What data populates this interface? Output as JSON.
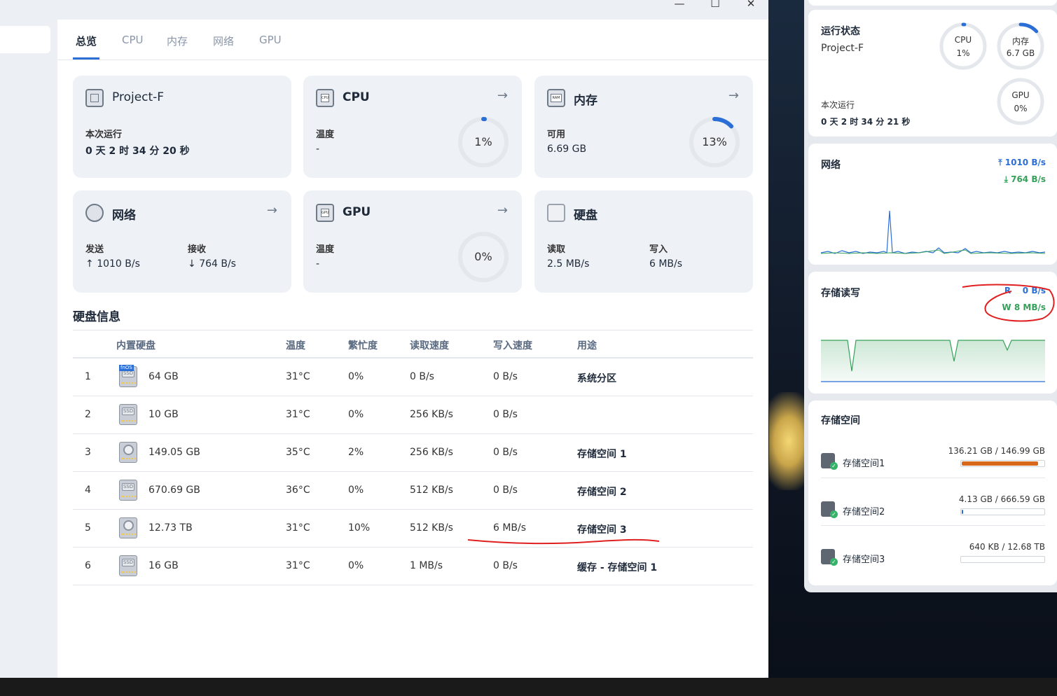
{
  "window": {
    "controls": {
      "minimize": "—",
      "maximize": "☐",
      "close": "✕"
    }
  },
  "tabs": [
    {
      "label": "总览",
      "active": true
    },
    {
      "label": "CPU",
      "active": false
    },
    {
      "label": "内存",
      "active": false
    },
    {
      "label": "网络",
      "active": false
    },
    {
      "label": "GPU",
      "active": false
    }
  ],
  "cards": {
    "system": {
      "name": "Project-F",
      "uptime_label": "本次运行",
      "uptime_value": "0 天 2 时 34 分 20 秒"
    },
    "cpu": {
      "title": "CPU",
      "temp_label": "温度",
      "temp_value": "-",
      "usage": "1%",
      "usage_fraction": 0.01
    },
    "memory": {
      "title": "内存",
      "avail_label": "可用",
      "avail_value": "6.69 GB",
      "usage": "13%",
      "usage_fraction": 0.13
    },
    "network": {
      "title": "网络",
      "send_label": "发送",
      "send_value": "1010 B/s",
      "recv_label": "接收",
      "recv_value": "764 B/s"
    },
    "gpu": {
      "title": "GPU",
      "temp_label": "温度",
      "temp_value": "-",
      "usage": "0%",
      "usage_fraction": 0
    },
    "disk": {
      "title": "硬盘",
      "read_label": "读取",
      "read_value": "2.5 MB/s",
      "write_label": "写入",
      "write_value": "6 MB/s"
    }
  },
  "disk_info": {
    "title": "硬盘信息",
    "headers": [
      "内置硬盘",
      "温度",
      "繁忙度",
      "读取速度",
      "写入速度",
      "用途"
    ],
    "rows": [
      {
        "idx": "1",
        "type": "ssd",
        "badge": "fnOS",
        "size": "64 GB",
        "temp": "31°C",
        "busy": "0%",
        "read": "0 B/s",
        "write": "0 B/s",
        "use": "系统分区"
      },
      {
        "idx": "2",
        "type": "ssd",
        "badge": "",
        "size": "10 GB",
        "temp": "31°C",
        "busy": "0%",
        "read": "256 KB/s",
        "write": "0 B/s",
        "use": ""
      },
      {
        "idx": "3",
        "type": "hdd",
        "badge": "",
        "size": "149.05 GB",
        "temp": "35°C",
        "busy": "2%",
        "read": "256 KB/s",
        "write": "0 B/s",
        "use": "存储空间 1"
      },
      {
        "idx": "4",
        "type": "ssd",
        "badge": "",
        "size": "670.69 GB",
        "temp": "36°C",
        "busy": "0%",
        "read": "512 KB/s",
        "write": "0 B/s",
        "use": "存储空间 2"
      },
      {
        "idx": "5",
        "type": "hdd",
        "badge": "",
        "size": "12.73 TB",
        "temp": "31°C",
        "busy": "10%",
        "read": "512 KB/s",
        "write": "6 MB/s",
        "use": "存储空间 3"
      },
      {
        "idx": "6",
        "type": "ssd",
        "badge": "",
        "size": "16 GB",
        "temp": "31°C",
        "busy": "0%",
        "read": "1 MB/s",
        "write": "0 B/s",
        "use": "缓存 - 存储空间 1"
      }
    ],
    "ssd_label": "SSD"
  },
  "widgets": {
    "status": {
      "title": "运行状态",
      "host": "Project-F",
      "uptime_label": "本次运行",
      "uptime_value": "0 天 2 时 34 分 21 秒",
      "rings": [
        {
          "label": "CPU",
          "value": "1%",
          "fraction": 0.01
        },
        {
          "label": "内存",
          "value": "6.7 GB",
          "fraction": 0.13
        },
        {
          "label": "GPU",
          "value": "0%",
          "fraction": 0
        }
      ]
    },
    "network": {
      "title": "网络",
      "up": "1010 B/s",
      "down": "764 B/s",
      "up_color": "#2b6fd6",
      "down_color": "#36a05a"
    },
    "storage_io": {
      "title": "存储读写",
      "r_label": "R",
      "r_value": "0 B/s",
      "w_label": "W",
      "w_value": "8 MB/s"
    },
    "storage_space": {
      "title": "存储空间",
      "items": [
        {
          "name": "存储空间1",
          "used": "136.21 GB",
          "total": "146.99 GB",
          "fraction": 0.93,
          "color": "#d9691a"
        },
        {
          "name": "存储空间2",
          "used": "4.13 GB",
          "total": "666.59 GB",
          "fraction": 0.01,
          "color": "#2b6fd6"
        },
        {
          "name": "存储空间3",
          "used": "640 KB",
          "total": "12.68 TB",
          "fraction": 0.0,
          "color": "#2b6fd6"
        }
      ]
    }
  },
  "colors": {
    "accent": "#2b6fd6",
    "annotation": "#e02020",
    "orange_bar": "#d9691a",
    "green": "#36a05a"
  }
}
